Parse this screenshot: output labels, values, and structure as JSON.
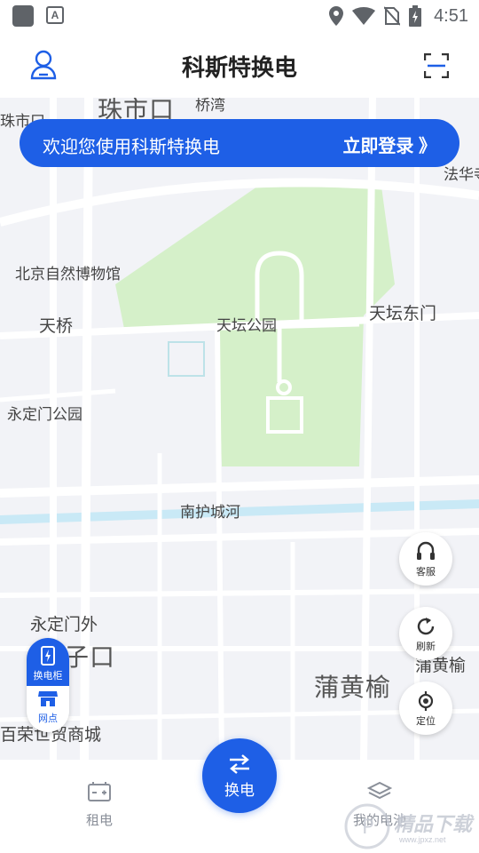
{
  "status_bar": {
    "time": "4:51",
    "icons": [
      "app-icon",
      "a-icon",
      "location-icon",
      "wifi-icon",
      "no-sim-icon",
      "battery-charging-icon"
    ]
  },
  "header": {
    "title": "科斯特换电",
    "left_icon": "user-icon",
    "right_icon": "scan-icon"
  },
  "login_banner": {
    "text": "欢迎您使用科斯特换电",
    "action": "立即登录 》"
  },
  "map": {
    "labels": {
      "zhushikou_left": "珠市口",
      "zhushikou_big": "珠市口",
      "qiaowan": "桥湾",
      "fahua": "法华寺",
      "museum": "北京自然博物馆",
      "tianqiao": "天桥",
      "tiantan_park": "天坛公园",
      "tiantan_east": "天坛东门",
      "yongdingmen_park": "永定门公园",
      "nanhu_river": "南护城河",
      "yongdingmen_out": "永定门外",
      "zikou": "子口",
      "puhuangyu_big": "蒲黄榆",
      "puhuangyu": "蒲黄榆",
      "bairong": "百荣世贸商城"
    },
    "colors": {
      "background": "#f2f3f7",
      "park": "#d5f0c9",
      "river": "#c9e9f6",
      "road": "#ffffff"
    }
  },
  "floating_buttons": {
    "service": "客服",
    "refresh": "刷新",
    "locate": "定位"
  },
  "left_pill": {
    "cabinet": "换电柜",
    "outlet": "网点"
  },
  "bottom_nav": {
    "rent": "租电",
    "swap": "换电",
    "my_battery": "我的电池"
  },
  "watermark": {
    "text": "精品下载",
    "site": "www.jpxz.net"
  },
  "accent_color": "#1e5fe6"
}
